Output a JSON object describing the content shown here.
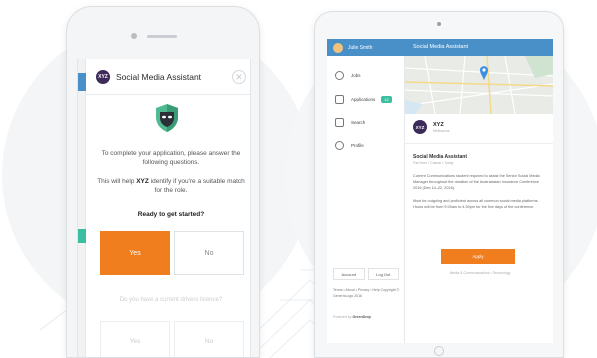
{
  "phone": {
    "header_logo": "XYZ",
    "header_title": "Social Media Assistant",
    "close_icon": "close-icon",
    "intro_text": "To complete your application, please answer the following questions.",
    "help_text_before": "This will help ",
    "help_company": "XYZ",
    "help_text_after": " identify if you're a suitable match for the role.",
    "ready_label": "Ready to get started?",
    "yes_label": "Yes",
    "no_label": "No",
    "question": "Do you have a current drivers licence?",
    "yes2_label": "Yes",
    "no2_label": "No"
  },
  "tablet": {
    "user_name": "Julie Smith",
    "nav": [
      {
        "label": "Jobs",
        "icon": "location-pin-icon"
      },
      {
        "label": "Applications",
        "icon": "envelope-icon",
        "badge": "12"
      },
      {
        "label": "Search",
        "icon": "buildings-icon"
      },
      {
        "label": "Profile",
        "icon": "user-icon"
      }
    ],
    "account_label": "Account",
    "logout_label": "Log Out",
    "footer_links": "Terms • About • Privacy • Help Copyright © GenerIcLogo 2016",
    "powered_prefix": "Powered by ",
    "powered_brand": "GreenDrop",
    "header_title": "Social Media Assistant",
    "company_logo": "XYZ",
    "company_name": "XYZ",
    "company_sub": "Melbourne",
    "job_title": "Social Media Assistant",
    "job_sub": "Part time • Casual • Today",
    "para1": "Current Communications student required to assist the Senior Social Media Manager throughout the duration of the Australasian Insurance Conference 2016 (Dec 14–22, 2016).",
    "para2": "Must be outgoing and proficient across all common social media platforms. Hours will be from 9:00am to 4:30pm for the five days of the conference.",
    "apply_label": "Apply",
    "tags": "Media & Communications • Technology"
  },
  "colors": {
    "accent_orange": "#f07d1e",
    "header_blue": "#4a90c8",
    "badge_green": "#3bbfa0",
    "logo_purple": "#3d2b5a"
  }
}
